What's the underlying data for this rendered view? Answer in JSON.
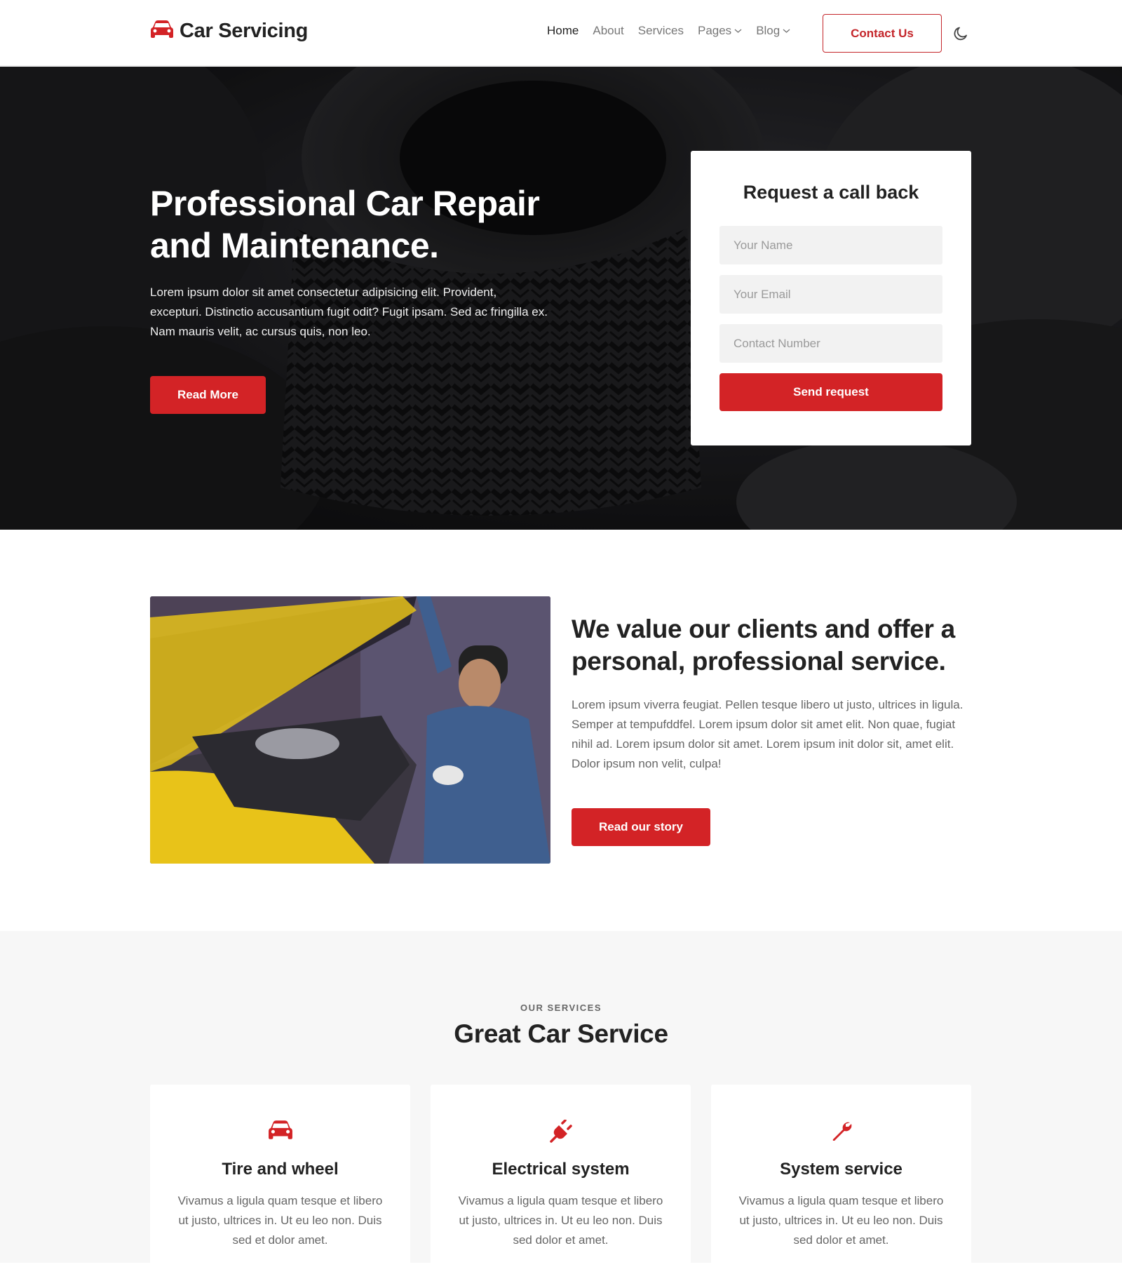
{
  "header": {
    "brand": "Car Servicing",
    "nav": [
      {
        "label": "Home",
        "active": true
      },
      {
        "label": "About"
      },
      {
        "label": "Services"
      },
      {
        "label": "Pages",
        "dropdown": true
      },
      {
        "label": "Blog",
        "dropdown": true
      }
    ],
    "contact_label": "Contact Us",
    "theme_icon": "moon-icon"
  },
  "hero": {
    "title": "Professional Car Repair and Maintenance.",
    "text": "Lorem ipsum dolor sit amet consectetur adipisicing elit. Provident, excepturi. Distinctio accusantium fugit odit? Fugit ipsam. Sed ac fringilla ex. Nam mauris velit, ac cursus quis, non leo.",
    "button_label": "Read More"
  },
  "callback": {
    "title": "Request a call back",
    "name_placeholder": "Your Name",
    "email_placeholder": "Your Email",
    "phone_placeholder": "Contact Number",
    "button_label": "Send request"
  },
  "about": {
    "title": "We value our clients and offer a personal, professional service.",
    "text": "Lorem ipsum viverra feugiat. Pellen tesque libero ut justo, ultrices in ligula. Semper at tempufddfel. Lorem ipsum dolor sit amet elit. Non quae, fugiat nihil ad. Lorem ipsum dolor sit amet. Lorem ipsum init dolor sit, amet elit. Dolor ipsum non velit, culpa!",
    "button_label": "Read our story"
  },
  "services": {
    "eyebrow": "OUR SERVICES",
    "title": "Great Car Service",
    "cards": [
      {
        "icon": "car-icon",
        "title": "Tire and wheel",
        "text": "Vivamus a ligula quam tesque et libero ut justo, ultrices in. Ut eu leo non. Duis sed et dolor amet."
      },
      {
        "icon": "plug-icon",
        "title": "Electrical system",
        "text": "Vivamus a ligula quam tesque et libero ut justo, ultrices in. Ut eu leo non. Duis sed dolor et amet."
      },
      {
        "icon": "wrench-icon",
        "title": "System service",
        "text": "Vivamus a ligula quam tesque et libero ut justo, ultrices in. Ut eu leo non. Duis sed dolor et amet."
      }
    ]
  },
  "colors": {
    "accent": "#d32326",
    "dark": "#222222",
    "muted": "#666666"
  }
}
